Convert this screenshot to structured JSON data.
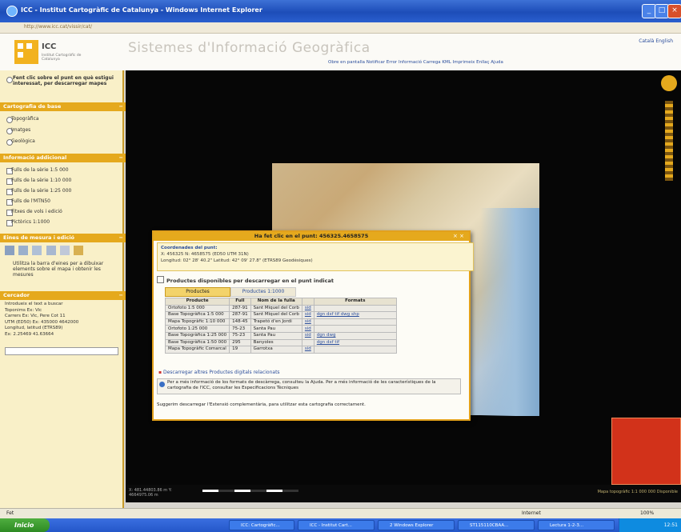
{
  "window": {
    "title": "ICC - Institut Cartogràfic de Catalunya - Windows Internet Explorer"
  },
  "addressbar": {
    "url": "http://www.icc.cat/vissir/cat/"
  },
  "header": {
    "logo_text": "ICC",
    "logo_sub": "Institut Cartogràfic de Catalunya",
    "banner": "Sistemes d'Informació Geogràfica",
    "links": "Català  English",
    "toolbar": "Obre en pantalla   Notificar Error   Informació   Carrega KML   Imprimeix   Enllaç   Ajuda"
  },
  "sidebar": {
    "intro": "Fent clic sobre el punt en què estigui interessat, per descarregar mapes",
    "cartografia": {
      "title": "Cartografia de base",
      "options": [
        "Topogràfica",
        "Imatges",
        "Geològica"
      ]
    },
    "informacio": {
      "title": "Informació addicional",
      "options": [
        "Fulls de la sèrie 1:5 000",
        "Fulls de la sèrie 1:10 000",
        "Fulls de la sèrie 1:25 000",
        "Fulls de l'MTN50",
        "Fitxes de vols i edició",
        "Pictòrics 1:1000"
      ]
    },
    "eines": {
      "title": "Eines de mesura i edició",
      "text": "Utilitza la barra d'eines per a dibuixar elements sobre el mapa i obtenir les mesures"
    },
    "cercador": {
      "title": "Cercador",
      "lines": [
        "Introdueix el text a buscar",
        "Toponims Ex: Vic",
        "Carrers Ex: Vic, Pere Cot 11",
        "UTM (ED50) Ex: 435000 4642000",
        "Longitud, latitud (ETRS89)",
        "Ex: 2.25469  41.63664"
      ]
    }
  },
  "popup": {
    "title": "Ha fet clic en el punt: 456325.4658575",
    "coords_title": "Coordenades del punt:",
    "coords_line1": "X: 456325  N: 4658575 (ED50 UTM 31N)",
    "coords_line2": "Longitud: 02° 28' 40.2\"  Latitud: 42° 09' 27.8\" (ETRS89 Geodèsiques)",
    "products_heading": "Productes disponibles per descarregar en el punt indicat",
    "tabs": [
      "Productes",
      "Productes 1:1000"
    ],
    "table": {
      "headers": [
        "Producte",
        "Full",
        "Nom de la fulla",
        "",
        "Formats"
      ],
      "rows": [
        [
          "Ortofoto 1:5 000",
          "287-91",
          "Sant Miquel del Corb",
          "sid",
          ""
        ],
        [
          "Base Topogràfica 1:5 000",
          "287-91",
          "Sant Miquel del Corb",
          "sid",
          "dgn  dxf  tif  dwg  shp"
        ],
        [
          "Mapa Topogràfic 1:10 000",
          "148-45",
          "Trapetó d'en Jordi",
          "sid",
          ""
        ],
        [
          "Ortofoto 1:25 000",
          "75-23",
          "Santa Pau",
          "sid",
          ""
        ],
        [
          "Base Topogràfica 1:25 000",
          "75-23",
          "Santa Pau",
          "sid",
          "dgn  dwg"
        ],
        [
          "Base Topogràfica 1:50 000",
          "295",
          "Banyoles",
          "",
          "dgn  dxf  tif"
        ],
        [
          "Mapa Topogràfic Comarcal",
          "19",
          "Garrotxa",
          "sid",
          ""
        ]
      ]
    },
    "other_products": "Descarregar altres Productes digitals relacionats",
    "info_text": "Per a més informació de los formats de descàrrega, consulteu la Ajuda. Per a més informació de les característiques de la cartografia de l'ICC, consultar les Especificacions Tècniques",
    "footer": "Suggerim descarregar l'Extensió complementària, para utilitzar esta cartografia correctament."
  },
  "map": {
    "status_left": "X: 481.44803.86 m   Y: 4664975.06 m",
    "scale_right": "Mapa topogràfic 1:1 000 000  Disponible"
  },
  "ie_status": {
    "left": "Fet",
    "zone": "Internet",
    "zoom": "100%"
  },
  "taskbar": {
    "start": "Inicio",
    "tasks": [
      "ICC: Cartogràfic...",
      "ICC - Institut Cart...",
      "2 Windows Explorer",
      "ST115110CBAA...",
      "Lectura 1-2-3..."
    ],
    "clock": "12:51"
  }
}
